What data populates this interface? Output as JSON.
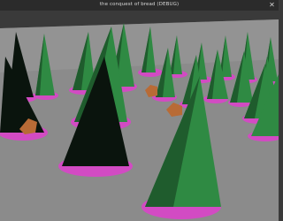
{
  "window": {
    "title": "the conquest of bread (DEBUG)",
    "close_icon": "close-icon"
  },
  "scene": {
    "ground_color": "#8b8b8b",
    "sky_color": "#3a3a3a",
    "tree_color": "#2f8a43",
    "tree_shadow_color": "#0a140d",
    "base_color": "#d24bc3",
    "rock_color": "#b86b36"
  }
}
